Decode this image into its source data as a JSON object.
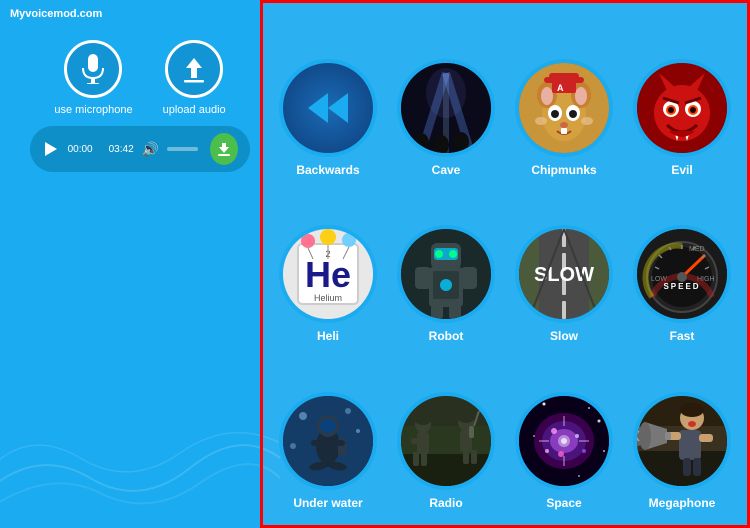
{
  "brand": "Myvoicemod.com",
  "left": {
    "use_mic_label": "use microphone",
    "upload_label": "upload audio",
    "player": {
      "time_current": "00:00",
      "time_total": "03:42",
      "download_label": "Download"
    }
  },
  "voices": [
    {
      "id": "backwards",
      "label": "Backwards",
      "icon_type": "rewind"
    },
    {
      "id": "cave",
      "label": "Cave",
      "icon_type": "image"
    },
    {
      "id": "chipmunks",
      "label": "Chipmunks",
      "icon_type": "image"
    },
    {
      "id": "evil",
      "label": "Evil",
      "icon_type": "image"
    },
    {
      "id": "heli",
      "label": "Heli",
      "icon_type": "image"
    },
    {
      "id": "robot",
      "label": "Robot",
      "icon_type": "image"
    },
    {
      "id": "slow",
      "label": "Slow",
      "icon_type": "image"
    },
    {
      "id": "fast",
      "label": "Fast",
      "icon_type": "image"
    },
    {
      "id": "underwater",
      "label": "Under water",
      "icon_type": "image"
    },
    {
      "id": "radio",
      "label": "Radio",
      "icon_type": "image"
    },
    {
      "id": "space",
      "label": "Space",
      "icon_type": "image"
    },
    {
      "id": "megaphone",
      "label": "Megaphone",
      "icon_type": "image"
    }
  ]
}
